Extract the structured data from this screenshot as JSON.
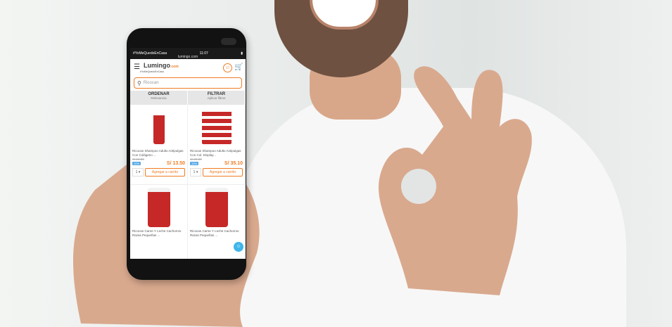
{
  "status": {
    "carrier": "#YoMeQuedoEnCasa",
    "time": "11:07",
    "url": "lumingo.com"
  },
  "header": {
    "logo_main": "Lumingo",
    "logo_suffix": ".com",
    "tagline": "#YoMeQuedoEnCasa",
    "menu_icon": "menu-icon",
    "user_icon": "user-icon",
    "cart_icon": "cart-icon"
  },
  "search": {
    "value": "Ricocan",
    "icon": "search-icon"
  },
  "filters": {
    "order_label": "ORDENAR",
    "order_value": "Relevancia",
    "filter_label": "FILTRAR",
    "filter_value": "Aplicar filtros"
  },
  "products": [
    {
      "name": "Ricocan Shampoo Adulto Antipulgas Con Colágeno ...",
      "old_price": "S/ 15.00",
      "discount": "10%",
      "price": "S/ 13.50",
      "qty": "1",
      "button": "Agregar a carrito"
    },
    {
      "name": "Ricocan Shampoo Adulto Antipulgas Con Col. Display...",
      "old_price": "S/ 39.00",
      "discount": "10%",
      "price": "S/ 35.10",
      "qty": "1",
      "button": "Agregar a carrito"
    },
    {
      "name": "Ricocan Carne Y Leche Cachorros Razas Pequeñas ...",
      "old_price": ""
    },
    {
      "name": "Ricocan Carne Y Leche Cachorros Razas Pequeñas ...",
      "old_price": ""
    }
  ],
  "colors": {
    "brand_orange": "#f07c22",
    "discount_blue": "#5aa9e6",
    "product_red": "#c62828"
  }
}
